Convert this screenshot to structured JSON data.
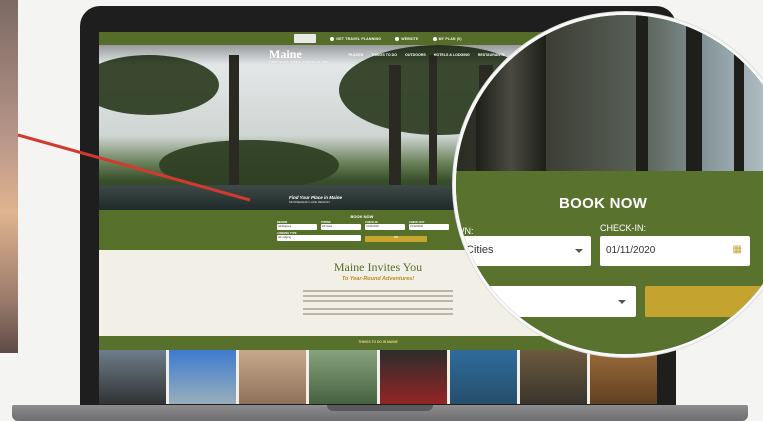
{
  "site": {
    "logo": "Maine",
    "logo_sub": "THE WAY LIFE SHOULD BE"
  },
  "topbar": {
    "items": [
      "GET TRAVEL PLANNING",
      "WEBSITE",
      "MY PLAN (0)"
    ]
  },
  "nav": {
    "items": [
      "PLACES",
      "THINGS TO DO",
      "OUTDOORS",
      "HOTELS & LODGING",
      "RESTAURANTS",
      "PLAN"
    ]
  },
  "hero": {
    "caption": "Find Your Place in Maine",
    "caption_sub": "MOOSEHEAD LAKE REGION"
  },
  "booking_small": {
    "title": "BOOK NOW",
    "labels": [
      "REGION",
      "TOWNS",
      "CHECK-IN",
      "CHECK-OUT",
      "LODGING TYPE"
    ],
    "values": [
      "All Regions",
      "All Cities",
      "01/11/2020",
      "01/12/2020",
      "All Lodging"
    ],
    "button": "GO"
  },
  "invite": {
    "title": "Maine Invites You",
    "subtitle": "To Year-Round Adventures!"
  },
  "things": {
    "label": "THINGS TO DO IN MAINE"
  },
  "zoom": {
    "title": "BOOK NOW",
    "label_town": "WN:",
    "label_checkin": "CHECK-IN:",
    "town_value": "Cities",
    "checkin_value": "01/11/2020",
    "calendar_icon": "calendar-icon"
  },
  "colors": {
    "brand_green": "#56702b",
    "accent_gold": "#c4a42f",
    "pointer_red": "#d33a2f"
  }
}
